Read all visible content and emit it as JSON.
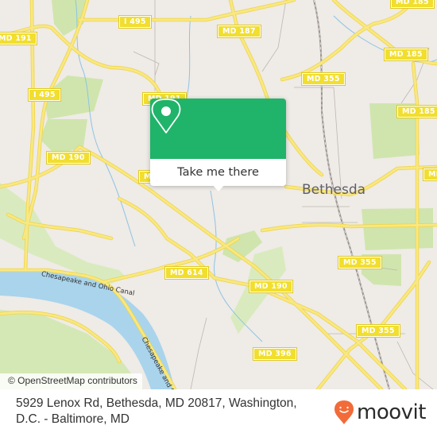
{
  "map": {
    "place_label": "Bethesda",
    "route_shields": [
      {
        "id": "i495-top",
        "label": "I 495"
      },
      {
        "id": "i495-left",
        "label": "I 495"
      },
      {
        "id": "md191-left",
        "label": "MD 191"
      },
      {
        "id": "md191-mid",
        "label": "MD 191"
      },
      {
        "id": "md187",
        "label": "MD 187"
      },
      {
        "id": "md185-top",
        "label": "MD 185"
      },
      {
        "id": "md185-mid",
        "label": "MD 185"
      },
      {
        "id": "md185-right",
        "label": "MD 185"
      },
      {
        "id": "md355-top",
        "label": "MD 355"
      },
      {
        "id": "md355-mid",
        "label": "MD 355"
      },
      {
        "id": "md355-bottom",
        "label": "MD 355"
      },
      {
        "id": "md190-left",
        "label": "MD 190"
      },
      {
        "id": "md190-right",
        "label": "MD 190"
      },
      {
        "id": "md614",
        "label": "MD 614"
      },
      {
        "id": "md396",
        "label": "MD 396"
      },
      {
        "id": "md-partial-right",
        "label": "MD"
      },
      {
        "id": "md-partial-left",
        "label": "MD"
      }
    ],
    "canal_labels": [
      "Chesapeake and Ohio Canal",
      "Chesapeake and Ohio"
    ],
    "attribution": "© OpenStreetMap contributors",
    "colors": {
      "land": "#efebe7",
      "park": "#cfe5ad",
      "water": "#a9d4ec",
      "road": "#f6e16a",
      "shield": "#f1de2e"
    }
  },
  "popup": {
    "button_label": "Take me there",
    "accent_color": "#1fb46a"
  },
  "footer": {
    "address": "5929 Lenox Rd, Bethesda, MD 20817, Washington, D.C. - Baltimore, MD",
    "brand": "moovit",
    "brand_color": "#f26b38"
  }
}
